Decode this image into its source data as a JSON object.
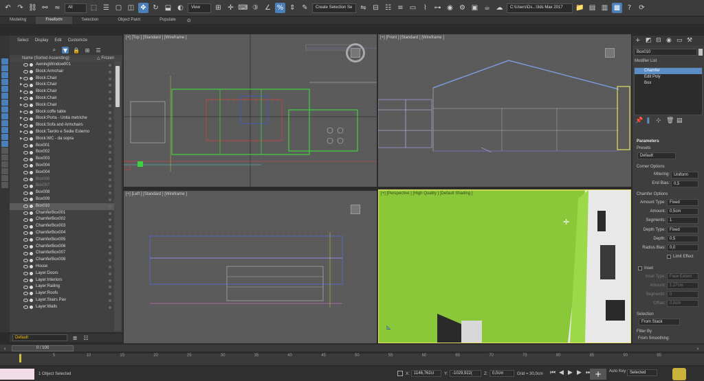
{
  "toolbar": {
    "filter": "All",
    "coord": "View",
    "named_selection": "Create Selection Se",
    "path": "C:\\Users\\Ds...\\3ds Max 2017"
  },
  "ribbon": {
    "tabs": [
      "Modeling",
      "Freeform",
      "Selection",
      "Object Paint",
      "Populate"
    ],
    "active": 1
  },
  "scene_explorer": {
    "menu": [
      "Select",
      "Display",
      "Edit",
      "Customize"
    ],
    "column_name": "Name (Sorted Ascending)",
    "column_frozen": "△ Frozen",
    "rows": [
      {
        "name": "AwningWindow001",
        "arrow": false,
        "dim": false,
        "sel": false
      },
      {
        "name": "Block:Armchair",
        "arrow": false,
        "dim": false,
        "sel": false
      },
      {
        "name": "Block:Chair",
        "arrow": true,
        "dim": false,
        "sel": false
      },
      {
        "name": "Block:Chair",
        "arrow": true,
        "dim": false,
        "sel": false
      },
      {
        "name": "Block:Chair",
        "arrow": true,
        "dim": false,
        "sel": false
      },
      {
        "name": "Block:Chair",
        "arrow": true,
        "dim": false,
        "sel": false
      },
      {
        "name": "Block:Chair",
        "arrow": true,
        "dim": false,
        "sel": false
      },
      {
        "name": "Block:coffe table",
        "arrow": true,
        "dim": false,
        "sel": false
      },
      {
        "name": "Block:Porta - Unità metriche",
        "arrow": true,
        "dim": false,
        "sel": false
      },
      {
        "name": "Block:Sofa and Armchairs",
        "arrow": true,
        "dim": false,
        "sel": false
      },
      {
        "name": "Block:Tavolo e Sedie Esterno",
        "arrow": true,
        "dim": false,
        "sel": false
      },
      {
        "name": "Block:WC - da sopra",
        "arrow": true,
        "dim": false,
        "sel": false
      },
      {
        "name": "Box001",
        "arrow": false,
        "dim": false,
        "sel": false
      },
      {
        "name": "Box002",
        "arrow": false,
        "dim": false,
        "sel": false
      },
      {
        "name": "Box003",
        "arrow": false,
        "dim": false,
        "sel": false
      },
      {
        "name": "Box004",
        "arrow": false,
        "dim": false,
        "sel": false
      },
      {
        "name": "Box004",
        "arrow": false,
        "dim": false,
        "sel": false
      },
      {
        "name": "Box006",
        "arrow": false,
        "dim": true,
        "sel": false
      },
      {
        "name": "Box007",
        "arrow": false,
        "dim": true,
        "sel": false
      },
      {
        "name": "Box008",
        "arrow": false,
        "dim": false,
        "sel": false
      },
      {
        "name": "Box009",
        "arrow": false,
        "dim": false,
        "sel": false
      },
      {
        "name": "Box010",
        "arrow": false,
        "dim": false,
        "sel": true
      },
      {
        "name": "ChamferBox001",
        "arrow": false,
        "dim": false,
        "sel": false
      },
      {
        "name": "ChamferBox002",
        "arrow": false,
        "dim": false,
        "sel": false
      },
      {
        "name": "ChamferBox003",
        "arrow": false,
        "dim": false,
        "sel": false
      },
      {
        "name": "ChamferBox004",
        "arrow": false,
        "dim": false,
        "sel": false
      },
      {
        "name": "ChamferBox005",
        "arrow": false,
        "dim": false,
        "sel": false
      },
      {
        "name": "ChamferBox006",
        "arrow": false,
        "dim": false,
        "sel": false
      },
      {
        "name": "ChamferBox007",
        "arrow": false,
        "dim": false,
        "sel": false
      },
      {
        "name": "ChamferBox008",
        "arrow": false,
        "dim": false,
        "sel": false
      },
      {
        "name": "House",
        "arrow": false,
        "dim": false,
        "sel": false
      },
      {
        "name": "Layer:Doors",
        "arrow": false,
        "dim": false,
        "sel": false
      },
      {
        "name": "Layer:Interiors",
        "arrow": false,
        "dim": false,
        "sel": false
      },
      {
        "name": "Layer:Railing",
        "arrow": false,
        "dim": false,
        "sel": false
      },
      {
        "name": "Layer:Roofs",
        "arrow": false,
        "dim": false,
        "sel": false
      },
      {
        "name": "Layer:Stairs Pav",
        "arrow": false,
        "dim": false,
        "sel": false
      },
      {
        "name": "Layer:Walls",
        "arrow": false,
        "dim": false,
        "sel": false
      }
    ],
    "layer": "Default"
  },
  "viewports": {
    "top": "[+] [Top ] [Standard ] [Wireframe ]",
    "front": "[+] [Front ] [Standard ] [Wireframe ]",
    "left": "[+] [Left ] [Standard ] [Wireframe ]",
    "persp": "[+] [Perspective ] [High Quality ] [Default Shading ]"
  },
  "command_panel": {
    "object_name": "Box010",
    "modifier_list": "Modifier List",
    "stack": [
      "Chamfer",
      "Edit Poly",
      "Box"
    ],
    "parameters": "Parameters",
    "presets_label": "Presets",
    "presets_value": "Default",
    "corner_options": "Corner Options",
    "mitering_label": "Mitering:",
    "mitering_value": "Uniform",
    "endbias_label": "End Bias:",
    "endbias_value": "0,5",
    "chamfer_options": "Chamfer Options",
    "amount_type_label": "Amount Type:",
    "amount_type_value": "Fixed",
    "amount_label": "Amount:",
    "amount_value": "0,5cm",
    "segments_label": "Segments:",
    "segments_value": "1",
    "depth_type_label": "Depth Type:",
    "depth_type_value": "Fixed",
    "depth_label": "Depth:",
    "depth_value": "0,5",
    "radius_bias_label": "Radius Bias:",
    "radius_bias_value": "0,0",
    "limit_effect": "Limit Effect",
    "inset": "Inset",
    "inset_type_label": "Inset Type:",
    "inset_type_value": "Face Extent",
    "inset_amount_label": "Amount:",
    "inset_amount_value": "1,27cm",
    "inset_segments_label": "Segments:",
    "inset_segments_value": "0",
    "offset_label": "Offset:",
    "offset_value": "0,0cm",
    "selection": "Selection",
    "selection_value": "From Stack",
    "filter_by": "Filter By",
    "from_smoothing": "From Smoothing:"
  },
  "timeline": {
    "slider": "0 / 100",
    "ticks": [
      "0",
      "5",
      "10",
      "15",
      "20",
      "25",
      "30",
      "35",
      "40",
      "45",
      "50",
      "55",
      "60",
      "65",
      "70",
      "75",
      "80",
      "85",
      "90",
      "95"
    ]
  },
  "status": {
    "selected": "1 Object Selected",
    "x_label": "X:",
    "x_value": "1146,762cl",
    "y_label": "Y:",
    "y_value": "-1029,922(",
    "z_label": "Z:",
    "z_value": "0,0cm",
    "grid": "Grid = 30,0cm",
    "auto_key": "Auto Key",
    "set_key_mode": "Selected"
  },
  "colors": {
    "accent": "#4a7fb8",
    "viewport_bg": "#5a5a5a",
    "persp_green": "#8ac83a",
    "selection_blue": "#5b8ec6"
  }
}
